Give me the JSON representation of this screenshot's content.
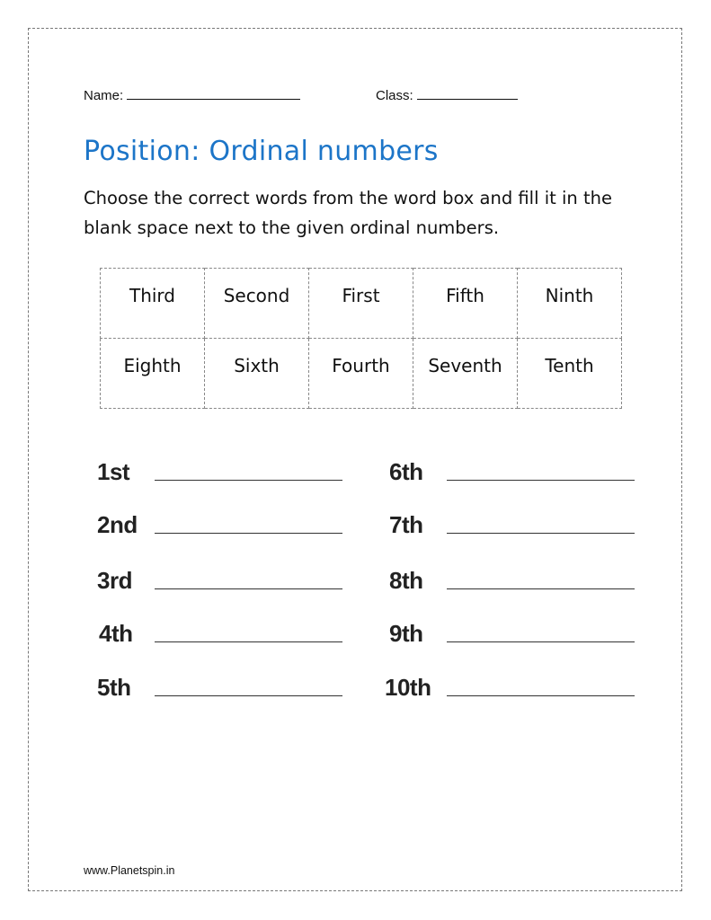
{
  "header": {
    "name_label": "Name:",
    "class_label": "Class:"
  },
  "title": "Position: Ordinal numbers",
  "instructions": "Choose the correct words from the word box and fill it in the blank space next to the given ordinal numbers.",
  "word_box": [
    [
      "Third",
      "Second",
      "First",
      "Fifth",
      "Ninth"
    ],
    [
      "Eighth",
      "Sixth",
      "Fourth",
      "Seventh",
      "Tenth"
    ]
  ],
  "ordinals": {
    "left": [
      "1st",
      "2nd",
      "3rd",
      "4th",
      "5th"
    ],
    "right": [
      "6th",
      "7th",
      "8th",
      "9th",
      "10th"
    ]
  },
  "footer": "www.Planetspin.in",
  "colors": {
    "title": "#1c75c8"
  }
}
